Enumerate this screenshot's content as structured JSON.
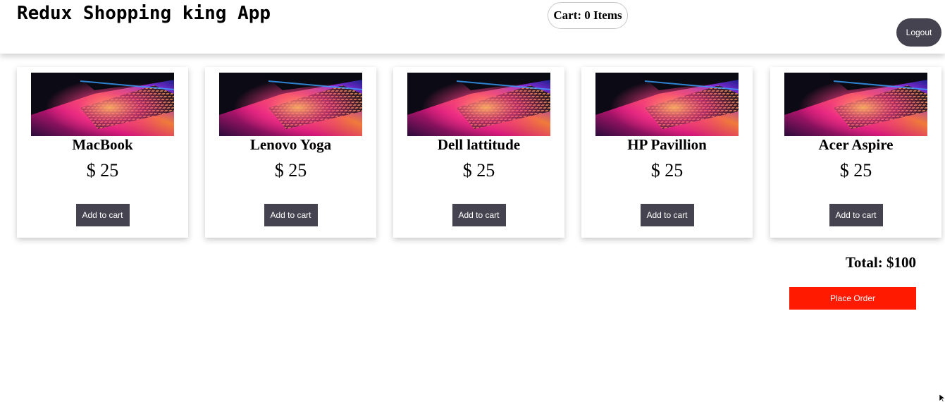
{
  "header": {
    "title": "Redux Shopping king App",
    "cart_label": "Cart: 0 Items",
    "logout_label": "Logout"
  },
  "products": [
    {
      "name": "MacBook",
      "price": "$ 25",
      "button_label": "Add to cart"
    },
    {
      "name": "Lenovo Yoga",
      "price": "$ 25",
      "button_label": "Add to cart"
    },
    {
      "name": "Dell lattitude",
      "price": "$ 25",
      "button_label": "Add to cart"
    },
    {
      "name": "HP Pavillion",
      "price": "$ 25",
      "button_label": "Add to cart"
    },
    {
      "name": "Acer Aspire",
      "price": "$ 25",
      "button_label": "Add to cart"
    }
  ],
  "summary": {
    "total_label": "Total: $100",
    "place_order_label": "Place Order"
  },
  "colors": {
    "dark_button": "#44434f",
    "place_order": "#ff1a00",
    "background": "#ffffff"
  },
  "icons": {
    "product_image": "laptop-keyboard-image",
    "cursor": "mouse-cursor-icon"
  }
}
